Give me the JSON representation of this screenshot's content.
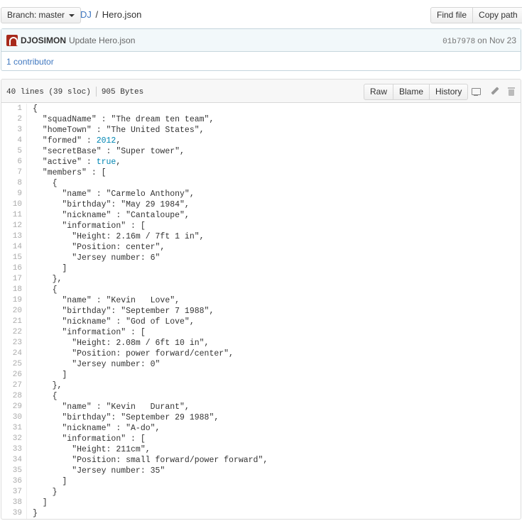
{
  "branch": {
    "label": "Branch:",
    "value": "master"
  },
  "breadcrumb": {
    "root": "DJ",
    "separator": "/",
    "file": "Hero.json"
  },
  "top_actions": {
    "find_file": "Find file",
    "copy_path": "Copy path"
  },
  "commit": {
    "author": "DJOSIMON",
    "message": "Update Hero.json",
    "sha": "01b7978",
    "date": "on Nov 23"
  },
  "contributors": {
    "count": "1",
    "label": "contributor"
  },
  "file": {
    "lines_info": "40 lines (39 sloc)",
    "size": "905 Bytes",
    "raw": "Raw",
    "blame": "Blame",
    "history": "History"
  },
  "icons": {
    "desktop": "desktop-icon",
    "pencil": "pencil-icon",
    "trash": "trash-icon",
    "branch_caret": "chevron-down-icon"
  },
  "colors": {
    "link": "#4078c0",
    "literal": "#0086b3",
    "commit_bg": "#f2f8fa",
    "avatar": "#a72a1c"
  },
  "code_lines": [
    "{",
    "  \"squadName\" : \"The dream ten team\",",
    "  \"homeTown\" : \"The United States\",",
    "  \"formed\" : 2012,",
    "  \"secretBase\" : \"Super tower\",",
    "  \"active\" : true,",
    "  \"members\" : [",
    "    {",
    "      \"name\" : \"Carmelo Anthony\",",
    "      \"birthday\": \"May 29 1984\",",
    "      \"nickname\" : \"Cantaloupe\",",
    "      \"information\" : [",
    "        \"Height: 2.16m / 7ft 1 in\",",
    "        \"Position: center\",",
    "        \"Jersey number: 6\"",
    "      ]",
    "    },",
    "    {",
    "      \"name\" : \"Kevin   Love\",",
    "      \"birthday\": \"September 7 1988\",",
    "      \"nickname\" : \"God of Love\",",
    "      \"information\" : [",
    "        \"Height: 2.08m / 6ft 10 in\",",
    "        \"Position: power forward/center\",",
    "        \"Jersey number: 0\"",
    "      ]",
    "    },",
    "    {",
    "      \"name\" : \"Kevin   Durant\",",
    "      \"birthday\": \"September 29 1988\",",
    "      \"nickname\" : \"A-do\",",
    "      \"information\" : [",
    "        \"Height: 211cm\",",
    "        \"Position: small forward/power forward\",",
    "        \"Jersey number: 35\"",
    "      ]",
    "    }",
    "  ]",
    "}"
  ]
}
